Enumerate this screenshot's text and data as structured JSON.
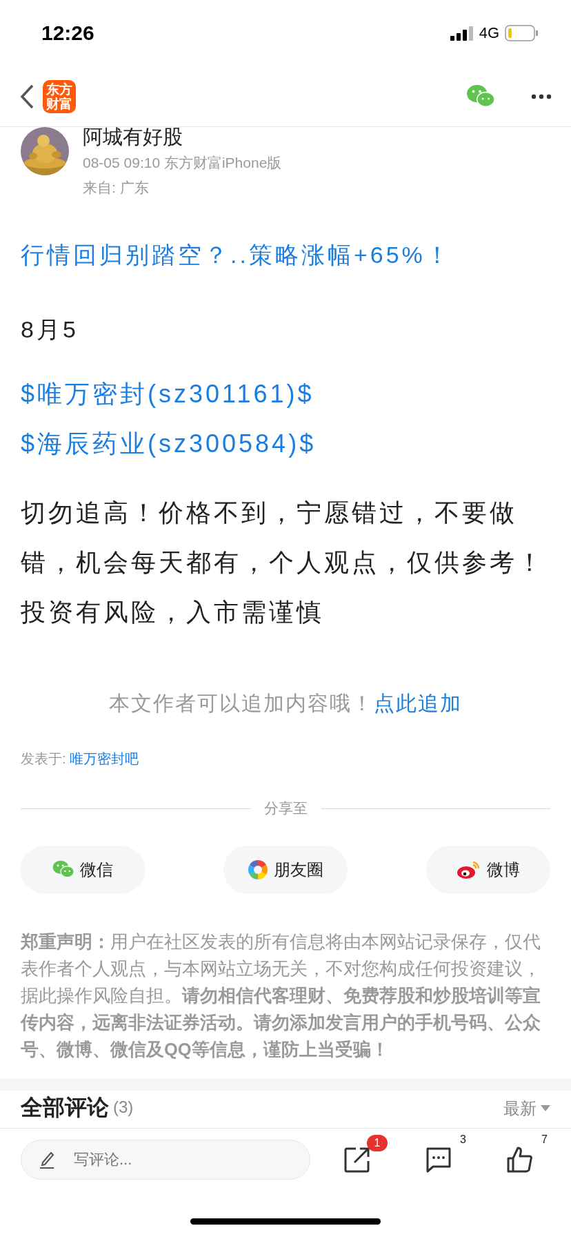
{
  "status_bar": {
    "time": "12:26",
    "network": "4G"
  },
  "nav": {
    "logo": "东方财富"
  },
  "post": {
    "author": "阿城有好股",
    "meta": "08-05 09:10 东方财富iPhone版",
    "location": "来自: 广东",
    "avatar": {
      "kind": "picture"
    },
    "title": "行情回归别踏空？..策略涨幅+65%！",
    "date": "8月5",
    "stock_links": [
      "$唯万密封(sz301161)$",
      "$海辰药业(sz300584)$"
    ],
    "body": "切勿追高！价格不到，宁愿错过，不要做错，机会每天都有，个人观点，仅供参考！投资有风险，入市需谨慎"
  },
  "append": {
    "text": "本文作者可以追加内容哦！",
    "link": "点此追加"
  },
  "posted_in": {
    "label": "发表于:",
    "forum": "唯万密封吧"
  },
  "share": {
    "title": "分享至",
    "targets": [
      {
        "kind": "wechat",
        "label": "微信"
      },
      {
        "kind": "moments",
        "label": "朋友圈"
      },
      {
        "kind": "weibo",
        "label": "微博"
      }
    ]
  },
  "disclaimer": "**郑重声明：**用户在社区发表的所有信息将由本网站记录保存，仅代表作者个人观点，与本网站立场无关，不对您构成任何投资建议，据此操作风险自担。**请勿相信代客理财、免费荐股和炒股培训等宣传内容，远离非法证券活动。请勿添加发言用户的手机号码、公众号、微博、微信及QQ等信息，谨防上当受骗！**",
  "comments": {
    "title": "全部评论",
    "count": "(3)",
    "sort": "最新"
  },
  "bottom_bar": {
    "placeholder": "写评论...",
    "share_badge": "1",
    "comment_count": "3",
    "like_count": "7"
  }
}
